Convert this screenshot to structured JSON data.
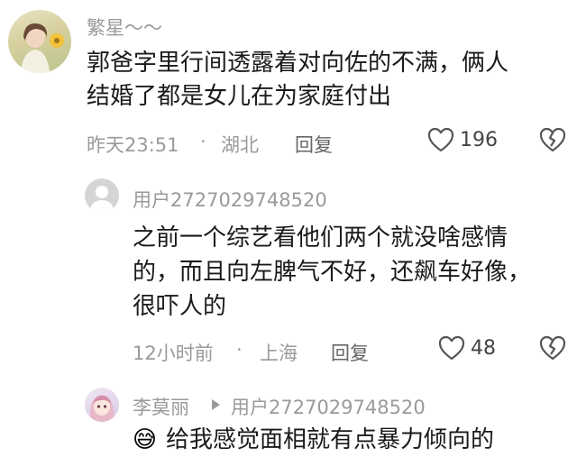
{
  "comment1": {
    "username": "繁星～～",
    "text_line1": "郭爸字里行间透露着对向佐的不满，俩人",
    "text_line2": "结婚了都是女儿在为家庭付出",
    "time": "昨天23:51",
    "dot": "·",
    "location": "湖北",
    "reply_label": "回复",
    "like_count": "196"
  },
  "reply1": {
    "username": "用户2727029748520",
    "text_line1": "之前一个综艺看他们两个就没啥感情",
    "text_line2": "的，而且向左脾气不好，还飙车好像，",
    "text_line3": "很吓人的",
    "time": "12小时前",
    "dot": "·",
    "location": "上海",
    "reply_label": "回复",
    "like_count": "48"
  },
  "reply2": {
    "username": "李莫丽",
    "reply_to": "用户2727029748520",
    "emoji": "😅",
    "text_partial": "给我感觉面相就有点暴力倾向的"
  },
  "colors": {
    "text": "#1a1a1a",
    "meta": "#9a9a9a",
    "icon": "#555555"
  }
}
